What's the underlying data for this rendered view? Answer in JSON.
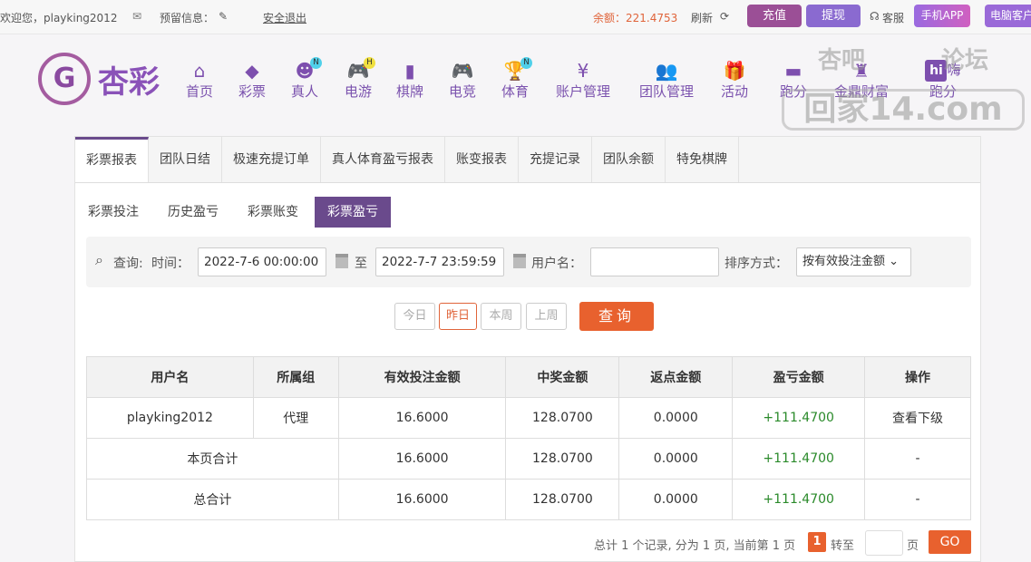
{
  "topbar": {
    "welcome": "欢迎您，playking2012",
    "reserved_label": "预留信息：",
    "logout": "安全退出",
    "balance": "余额：221.4753",
    "refresh": "刷新",
    "deposit": "充值",
    "withdraw": "提现",
    "service": "客服",
    "mobile_app": "手机APP",
    "pc_client": "电脑客户"
  },
  "logo": {
    "mark": "G",
    "text": "杏彩"
  },
  "nav": [
    {
      "label": "首页",
      "icon": "⌂"
    },
    {
      "label": "彩票",
      "icon": "◆"
    },
    {
      "label": "真人",
      "icon": "☻",
      "badge": "N"
    },
    {
      "label": "电游",
      "icon": "🎮",
      "badge": "H"
    },
    {
      "label": "棋牌",
      "icon": "▮"
    },
    {
      "label": "电竞",
      "icon": "🎮"
    },
    {
      "label": "体育",
      "icon": "🏆",
      "badge": "N"
    },
    {
      "label": "账户管理",
      "icon": "¥"
    },
    {
      "label": "团队管理",
      "icon": "👥"
    },
    {
      "label": "活动",
      "icon": "🎁"
    },
    {
      "label": "跑分",
      "icon": "▬"
    },
    {
      "label": "金鼎财富",
      "icon": "♜"
    },
    {
      "label": "嗨跑分",
      "icon": "hi"
    }
  ],
  "watermark": {
    "a": "杏吧",
    "b": "论坛",
    "c": "回家14.com"
  },
  "tabs": [
    "彩票报表",
    "团队日结",
    "极速充提订单",
    "真人体育盈亏报表",
    "账变报表",
    "充提记录",
    "团队余额",
    "特免棋牌"
  ],
  "subtabs": [
    "彩票投注",
    "历史盈亏",
    "彩票账变",
    "彩票盈亏"
  ],
  "search": {
    "query_label": "查询:",
    "time_label": "时间：",
    "start": "2022-7-6 00:00:00",
    "to": "至",
    "end": "2022-7-7 23:59:59",
    "user_label": "用户名：",
    "user_value": "",
    "sort_label": "排序方式：",
    "sort_value": "按有效投注金额"
  },
  "quick": [
    "今日",
    "昨日",
    "本周",
    "上周"
  ],
  "query_button": "查询",
  "table": {
    "headers": [
      "用户名",
      "所属组",
      "有效投注金额",
      "中奖金额",
      "返点金额",
      "盈亏金额",
      "操作"
    ],
    "rows": [
      [
        "playking2012",
        "代理",
        "16.6000",
        "128.0700",
        "0.0000",
        "+111.4700",
        "查看下级"
      ]
    ],
    "subtotal": [
      "本页合计",
      "16.6000",
      "128.0700",
      "0.0000",
      "+111.4700",
      "-"
    ],
    "total": [
      "总合计",
      "16.6000",
      "128.0700",
      "0.0000",
      "+111.4700",
      "-"
    ]
  },
  "pager": {
    "summary": "总计 1 个记录, 分为 1 页, 当前第 1 页",
    "current": "1",
    "goto": "转至",
    "page_unit": "页",
    "go": "GO"
  }
}
